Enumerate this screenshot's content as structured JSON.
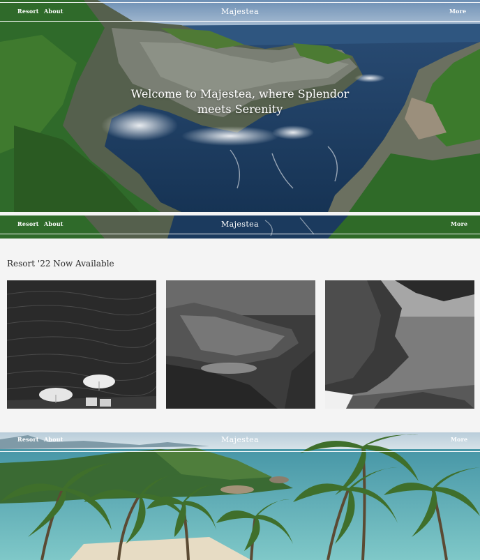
{
  "nav": {
    "left_links": [
      "Resort",
      "About"
    ],
    "brand": "Majestea",
    "right_link": "More"
  },
  "hero": {
    "title": "Welcome to Majestea, where Splendor meets Serenity"
  },
  "gallery": {
    "heading": "Resort '22 Now Available",
    "photos": [
      "beach-umbrellas-photo",
      "rocky-cove-photo",
      "coastal-cliff-photo"
    ]
  },
  "colors": {
    "nav_text": "#ffffff",
    "page_bg": "#f4f4f4",
    "heading_text": "#2b2b2b",
    "sea": "#1f3f66",
    "foliage": "#2f6a2a"
  }
}
